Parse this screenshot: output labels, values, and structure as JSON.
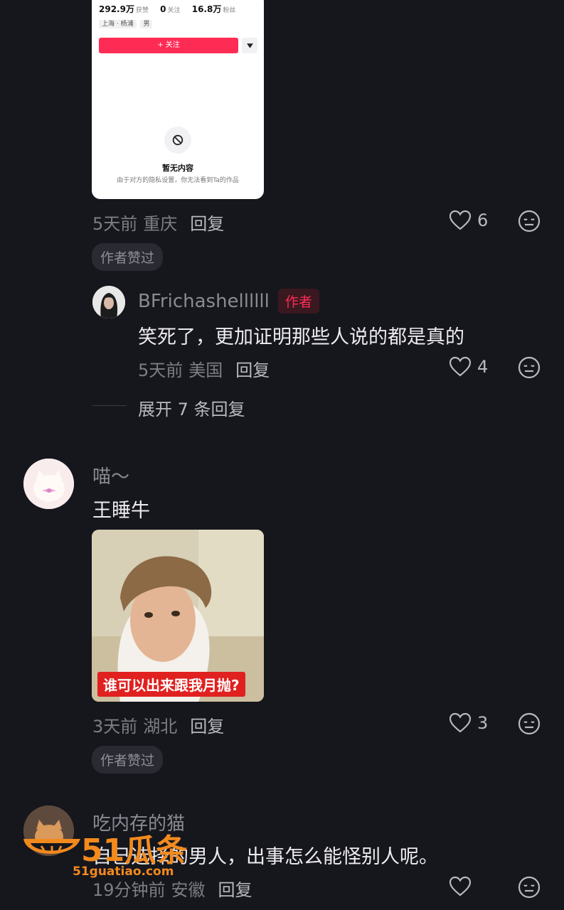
{
  "profile_card": {
    "likes_value": "292.9万",
    "likes_label": "获赞",
    "following_value": "0",
    "following_label": "关注",
    "fans_value": "16.8万",
    "fans_label": "粉丝",
    "location_tag": "上海 · 杨浦",
    "gender_tag": "男",
    "follow_button": "+ 关注",
    "empty_title": "暂无内容",
    "empty_subtitle": "由于对方的隐私设置，你无法看到Ta的作品"
  },
  "comment1": {
    "time": "5天前",
    "location": "重庆",
    "reply": "回复",
    "likes": "6",
    "author_liked": "作者赞过"
  },
  "reply1": {
    "username": "BFrichashellllll",
    "author_tag": "作者",
    "text": "笑死了，更加证明那些人说的都是真的",
    "time": "5天前",
    "location": "美国",
    "reply": "回复",
    "likes": "4"
  },
  "expand_replies": "展开 7 条回复",
  "comment2": {
    "username": "喵～",
    "text": "王睡牛",
    "image_caption": "谁可以出来跟我月抛?",
    "time": "3天前",
    "location": "湖北",
    "reply": "回复",
    "likes": "3",
    "author_liked": "作者赞过"
  },
  "comment3": {
    "username": "吃内存的猫",
    "text": "自己选择的男人，出事怎么能怪别人呢。",
    "time": "19分钟前",
    "location": "安徽",
    "reply": "回复"
  },
  "watermark": {
    "logo_text": "51瓜条",
    "url": "51guatiao.com"
  },
  "colors": {
    "background": "#16161d",
    "accent": "#fe2c55"
  }
}
